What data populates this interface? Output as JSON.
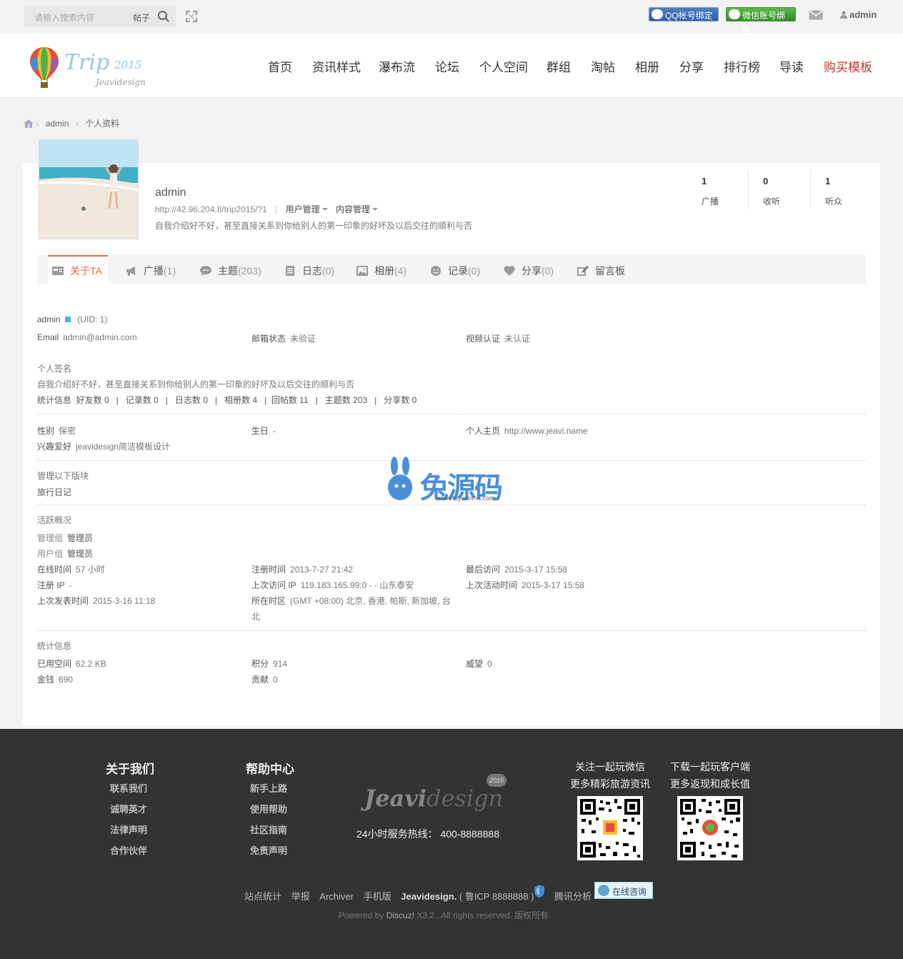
{
  "topbar": {
    "search_placeholder": "请输入搜索内容",
    "search_scope": "帖子",
    "qq_bind": "QQ帐号绑定",
    "wechat_bind": "微信账号绑定",
    "username": "admin"
  },
  "nav": [
    "首页",
    "资讯样式",
    "瀑布流",
    "论坛",
    "个人空间",
    "群组",
    "淘帖",
    "相册",
    "分享",
    "排行榜",
    "导读",
    "购买模板"
  ],
  "logo": {
    "brand": "Trip",
    "year": "2015",
    "sub": "Jeavidesign"
  },
  "breadcrumb": [
    "admin",
    "个人资料"
  ],
  "profile": {
    "name": "admin",
    "url": "http://42.96.204.8/trip2015/?1",
    "user_mgmt": "用户管理",
    "content_mgmt": "内容管理",
    "signature": "自我介绍好不好，甚至直接关系到你给别人的第一印象的好坏及以后交往的顺利与否",
    "stats": [
      {
        "num": "1",
        "label": "广播"
      },
      {
        "num": "0",
        "label": "收听"
      },
      {
        "num": "1",
        "label": "听众"
      }
    ]
  },
  "tabs": [
    {
      "label": "关于TA",
      "count": ""
    },
    {
      "label": "广播",
      "count": "(1)"
    },
    {
      "label": "主题",
      "count": "(203)"
    },
    {
      "label": "日志",
      "count": "(0)"
    },
    {
      "label": "相册",
      "count": "(4)"
    },
    {
      "label": "记录",
      "count": "(0)"
    },
    {
      "label": "分享",
      "count": "(0)"
    },
    {
      "label": "留言板",
      "count": ""
    }
  ],
  "detail": {
    "name": "admin",
    "uid": "(UID: 1)",
    "email_k": "Email",
    "email_v": "admin@admin.com",
    "mailstatus_k": "邮箱状态",
    "mailstatus_v": "未验证",
    "video_k": "视频认证",
    "video_v": "未认证",
    "sig_title": "个人签名",
    "sig_text": "自我介绍好不好，甚至直接关系到你给别人的第一印象的好坏及以后交往的顺利与否",
    "counts": "统计信息  好友数 0   |   记录数 0   |   日志数 0   |   相册数 4   |  回帖数 11   |   主题数 203   |   分享数 0",
    "gender_k": "性别",
    "gender_v": "保密",
    "birth_k": "生日",
    "birth_v": "-",
    "homepage_k": "个人主页",
    "homepage_v": "http://www.jeavi.name",
    "hobby_k": "兴趣爱好",
    "hobby_v": "jeavidesign简洁模板设计",
    "manage_title": "管理以下版块",
    "manage_v": "旅行日记",
    "activity_title": "活跃概况",
    "admingroup_k": "管理组",
    "admingroup_v": "管理员",
    "usergroup_k": "用户组",
    "usergroup_v": "管理员",
    "online_k": "在线时间",
    "online_v": "57 小时",
    "regtime_k": "注册时间",
    "regtime_v": "2013-7-27 21:42",
    "lastvisit_k": "最后访问",
    "lastvisit_v": "2015-3-17 15:58",
    "regip_k": "注册 IP",
    "regip_v": "-",
    "lastip_k": "上次访问 IP",
    "lastip_v": "119.183.165.99:0 - - 山东泰安",
    "lastactive_k": "上次活动时间",
    "lastactive_v": "2015-3-17 15:58",
    "lastpost_k": "上次发表时间",
    "lastpost_v": "2015-3-16 11:18",
    "tz_k": "所在时区",
    "tz_v1": "(GMT +08:00) 北京, 香港, 帕斯, 新加坡, 台",
    "tz_v2": "北",
    "stat_title": "统计信息",
    "space_k": "已用空间",
    "space_v": "62.2 KB",
    "credit_k": "积分",
    "credit_v": "914",
    "prestige_k": "威望",
    "prestige_v": "0",
    "money_k": "金钱",
    "money_v": "690",
    "contrib_k": "贡献",
    "contrib_v": "0"
  },
  "watermark": {
    "text": "兔源码",
    "url": "www.tuyuanma.com"
  },
  "footer": {
    "about_title": "关于我们",
    "about_links": [
      "联系我们",
      "诚聘英才",
      "法律声明",
      "合作伙伴"
    ],
    "help_title": "帮助中心",
    "help_links": [
      "新手上路",
      "使用帮助",
      "社区指南",
      "免责声明"
    ],
    "logo_a": "Jeavi",
    "logo_b": "design",
    "logo_badge": "2015",
    "hotline": "24小时服务热线：  400-8888888",
    "wechat_title1": "关注一起玩微信",
    "wechat_title2": "更多精彩旅游资讯",
    "app_title1": "下载一起玩客户端",
    "app_title2": "更多返现和成长值",
    "bar": [
      "站点统计",
      "举报",
      "Archiver",
      "手机版"
    ],
    "bar_brand": "Jeavidesign.",
    "icp": "( 鲁ICP 8888888 )",
    "tencent": "腾讯分析",
    "consult": "在线咨询",
    "powered_a": "Powered by ",
    "powered_b": "Discuz!",
    "powered_c": " X3.2 , All rights reserved. 版权所有"
  }
}
